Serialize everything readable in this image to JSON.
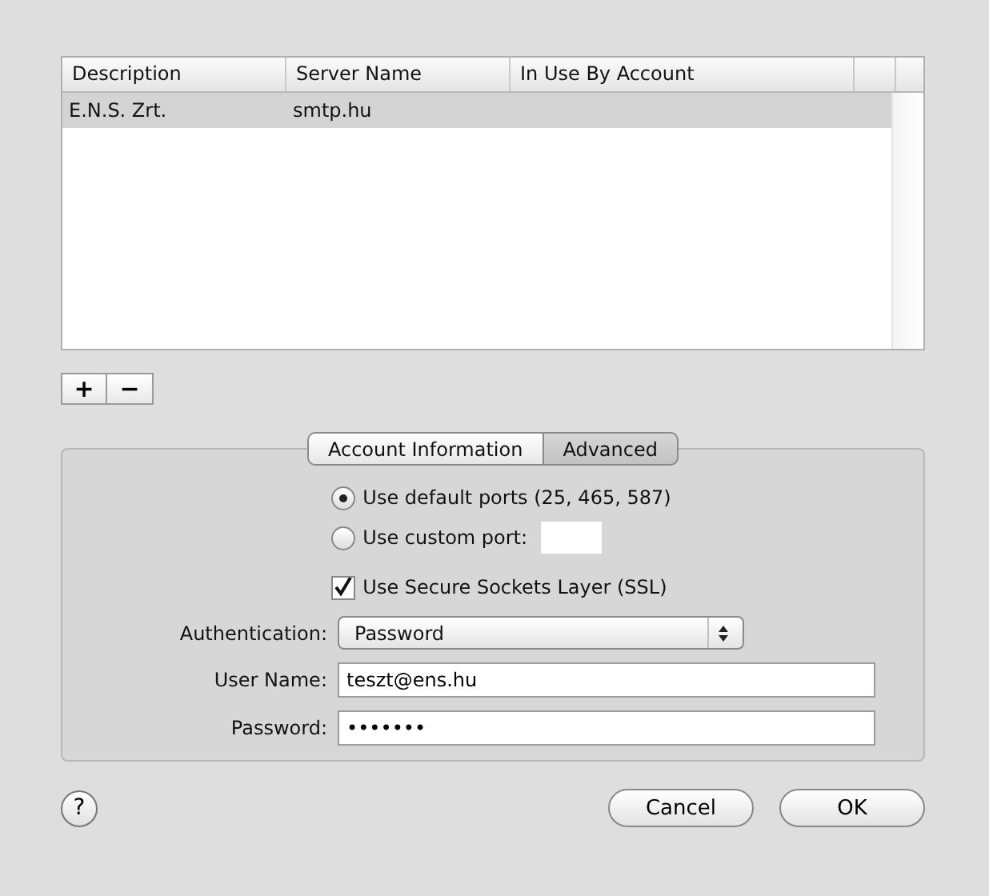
{
  "table": {
    "columns": [
      "Description",
      "Server Name",
      "In Use By Account"
    ],
    "rows": [
      {
        "cells": [
          "E.N.S. Zrt.",
          "smtp.hu",
          ""
        ],
        "selected": true
      }
    ]
  },
  "list_buttons": [
    "+",
    "−"
  ],
  "tabs": [
    {
      "label": "Account Information",
      "selected": false
    },
    {
      "label": "Advanced",
      "selected": true
    }
  ],
  "port_options": [
    {
      "label": "Use default ports (25, 465, 587)",
      "selected": true,
      "kind": "plain"
    },
    {
      "label": "Use custom port:",
      "selected": false,
      "kind": "field"
    }
  ],
  "ssl": {
    "label": "Use Secure Sockets Layer (SSL)",
    "checked": true
  },
  "authentication": {
    "label": "Authentication:",
    "value": "Password"
  },
  "user_name": {
    "label": "User Name:",
    "value": "teszt@ens.hu"
  },
  "password": {
    "label": "Password:",
    "value": "•••••••"
  },
  "help": "?",
  "buttons": [
    "Cancel",
    "OK"
  ]
}
